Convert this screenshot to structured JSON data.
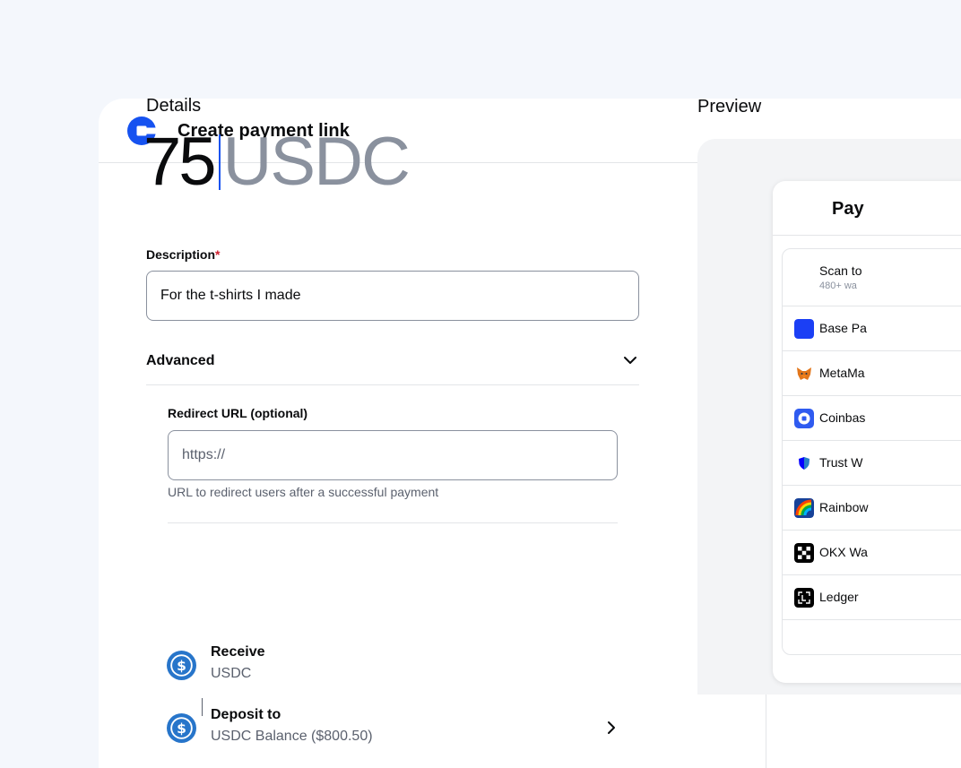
{
  "header": {
    "title": "Create payment link"
  },
  "details": {
    "heading": "Details",
    "amount": "75",
    "currency": "USDC"
  },
  "description": {
    "label": "Description",
    "required_mark": "*",
    "value": "For the t-shirts I made"
  },
  "advanced": {
    "label": "Advanced"
  },
  "redirect": {
    "label": "Redirect URL (optional)",
    "placeholder": "https://",
    "help": "URL to redirect users after a successful payment"
  },
  "receive": {
    "title": "Receive",
    "value": "USDC"
  },
  "deposit": {
    "title": "Deposit to",
    "value": "USDC Balance ($800.50)"
  },
  "preview": {
    "heading": "Preview",
    "card_title": "Pay",
    "scan_title": "Scan to",
    "scan_sub": "480+ wa",
    "wallets": [
      {
        "name": "Base Pa",
        "icon": "base-icon",
        "color": "#1b3ff5"
      },
      {
        "name": "MetaMa",
        "icon": "metamask-fox-icon",
        "color": "#e2761b"
      },
      {
        "name": "Coinbas",
        "icon": "coinbase-wallet-icon",
        "color": "#2f5bf0"
      },
      {
        "name": "Trust W",
        "icon": "trust-shield-icon",
        "color": "#0500ff"
      },
      {
        "name": "Rainbow",
        "icon": "rainbow-icon",
        "color": "#174299"
      },
      {
        "name": "OKX Wa",
        "icon": "okx-icon",
        "color": "#000000"
      },
      {
        "name": "Ledger",
        "icon": "ledger-icon",
        "color": "#000000"
      }
    ]
  },
  "colors": {
    "accent": "#1652f0",
    "usdc": "#2775ca",
    "muted": "#8a919e"
  }
}
